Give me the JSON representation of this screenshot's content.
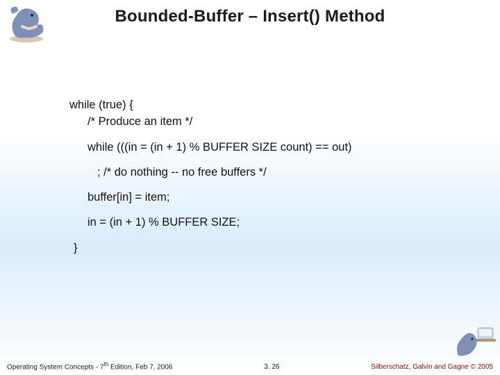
{
  "title": "Bounded-Buffer – Insert() Method",
  "code": {
    "l1": "while (true) {",
    "l2": "/* Produce an item */",
    "l3": "while (((in = (in + 1) % BUFFER SIZE count)  == out)",
    "l4": ";  /* do nothing -- no free buffers */",
    "l5": "buffer[in] = item;",
    "l6": "in = (in + 1) % BUFFER SIZE;",
    "l7": "}"
  },
  "footer": {
    "left_prefix": "Operating System Concepts - 7",
    "left_sup": "th",
    "left_suffix": " Edition, Feb 7, 2006",
    "center": "3. 26",
    "right": "Silberschatz, Galvin and Gagne © 2005"
  },
  "icons": {
    "dino_tl": "dinosaur-mascot-top-left",
    "dino_br": "dinosaur-mascot-bottom-right"
  }
}
